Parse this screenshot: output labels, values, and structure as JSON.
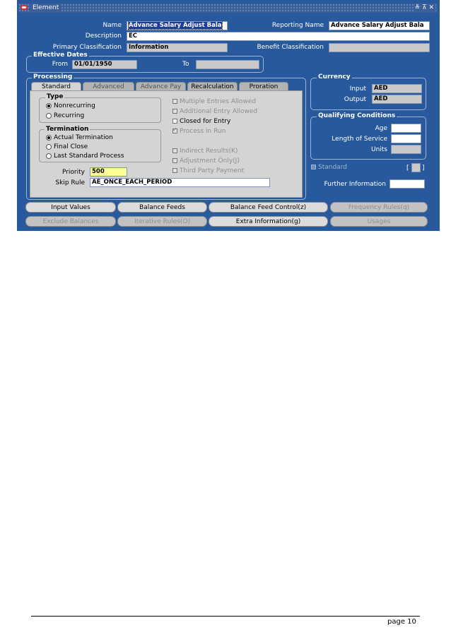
{
  "window": {
    "title": "Element",
    "controls": "≚ ⊼ ✕"
  },
  "form": {
    "name_label": "Name",
    "name_value": "Advance Salary Adjust Bala",
    "reporting_name_label": "Reporting Name",
    "reporting_name_value": "Advance Salary Adjust Bala",
    "description_label": "Description",
    "description_value": "EC",
    "primary_classification_label": "Primary Classification",
    "primary_classification_value": "Information",
    "benefit_classification_label": "Benefit Classification",
    "benefit_classification_value": ""
  },
  "effective_dates": {
    "header": "Effective Dates",
    "from_label": "From",
    "from_value": "01/01/1950",
    "to_label": "To",
    "to_value": ""
  },
  "processing": {
    "header": "Processing",
    "tabs": [
      "Standard",
      "Advanced",
      "Advance Pay",
      "Recalculation",
      "Proration"
    ],
    "type": {
      "header": "Type",
      "options": [
        "Nonrecurring",
        "Recurring"
      ]
    },
    "termination": {
      "header": "Termination",
      "options": [
        "Actual Termination",
        "Final Close",
        "Last Standard Process"
      ]
    },
    "checkboxes": [
      "Multiple Entries Allowed",
      "Additional Entry Allowed",
      "Closed for Entry",
      "Process in Run",
      "Indirect Results(K)",
      "Adjustment Only(J)",
      "Third Party Payment"
    ],
    "priority_label": "Priority",
    "priority_value": "500",
    "skip_rule_label": "Skip Rule",
    "skip_rule_value": "AE_ONCE_EACH_PERIOD"
  },
  "currency": {
    "header": "Currency",
    "input_label": "Input",
    "input_value": "AED",
    "output_label": "Output",
    "output_value": "AED"
  },
  "qualifying": {
    "header": "Qualifying Conditions",
    "age_label": "Age",
    "age_value": "",
    "los_label": "Length of Service",
    "los_value": "",
    "units_label": "Units",
    "units_value": ""
  },
  "standard_label": "Standard",
  "bracket_open": "[",
  "bracket_close": "]",
  "further_info_label": "Further Information",
  "buttons": {
    "row1": [
      "Input Values",
      "Balance Feeds",
      "Balance Feed Control(z)",
      "Frequency Rules(q)"
    ],
    "row2": [
      "Exclude Balances",
      "Iterative Rules(O)",
      "Extra Information(g)",
      "Usages"
    ]
  },
  "page_number": "page 10"
}
